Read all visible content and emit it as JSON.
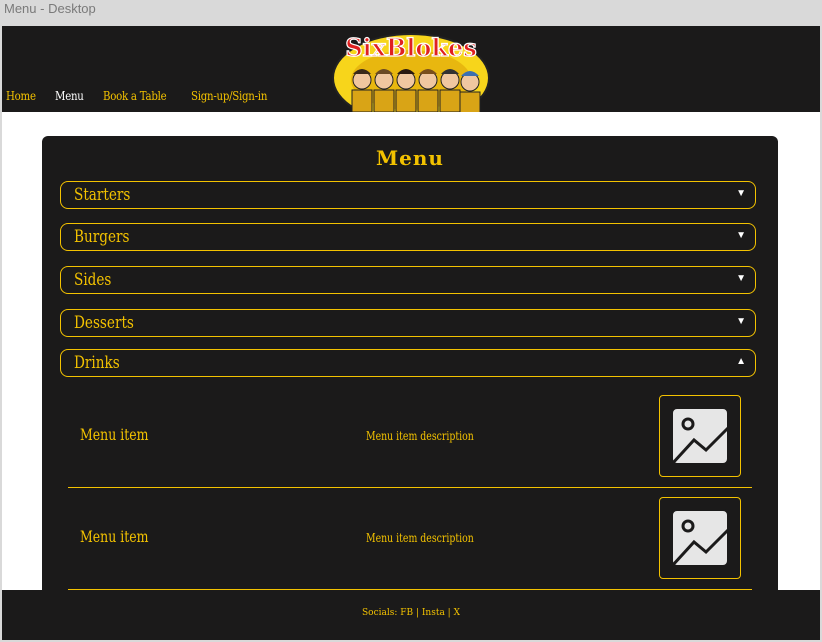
{
  "window": {
    "title": "Menu - Desktop"
  },
  "colors": {
    "accent": "#f3c200",
    "dark": "#1b1a1a",
    "page": "#ffffff"
  },
  "header": {
    "logo_text": "SixBlokes",
    "nav": [
      "Home",
      "Menu",
      "Book a Table",
      "Sign-up/Sign-in"
    ],
    "active": "Menu"
  },
  "panel": {
    "title": "Menu",
    "sections": [
      {
        "label": "Starters",
        "icon": "chevron-down-icon"
      },
      {
        "label": "Burgers",
        "icon": "chevron-down-icon"
      },
      {
        "label": "Sides",
        "icon": "chevron-down-icon"
      },
      {
        "label": "Desserts",
        "icon": "chevron-down-icon"
      },
      {
        "label": "Drinks",
        "icon": "chevron-up-icon",
        "expanded": true
      }
    ],
    "items": [
      {
        "name": "Menu item",
        "description": "Menu item description",
        "icon": "image-placeholder-icon"
      },
      {
        "name": "Menu item",
        "description": "Menu item description",
        "icon": "image-placeholder-icon"
      }
    ]
  },
  "footer": {
    "text": "Socials: FB | Insta | X"
  }
}
